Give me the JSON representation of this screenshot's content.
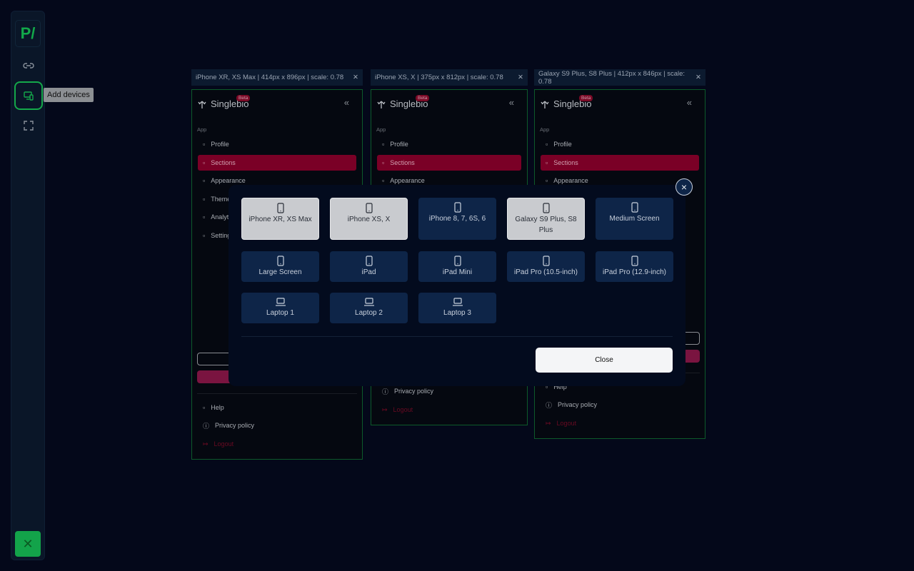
{
  "sidebar": {
    "logo": "P/",
    "tooltip": "Add devices",
    "icons": [
      "link-icon",
      "devices-icon",
      "fullscreen-icon"
    ],
    "exit_icon": "close-icon",
    "accent": "#13a34a"
  },
  "frames": [
    {
      "header": "iPhone XR, XS Max | 414px x 896px | scale: 0.78"
    },
    {
      "header": "iPhone XS, X | 375px x 812px | scale: 0.78"
    },
    {
      "header": "Galaxy S9 Plus, S8 Plus | 412px x 846px | scale: 0.78"
    }
  ],
  "app_preview": {
    "brand": "Singlebio",
    "beta": "Beta",
    "collapse": "«",
    "section_label": "App",
    "menu": [
      "Profile",
      "Sections",
      "Appearance",
      "Themes",
      "Analytics",
      "Settings"
    ],
    "active": "Sections",
    "help": "Help",
    "privacy": "Privacy policy",
    "logout": "Logout",
    "active_color": "#7a0026"
  },
  "modal": {
    "devices": [
      {
        "label": "iPhone XR, XS Max",
        "type": "phone",
        "selected": true
      },
      {
        "label": "iPhone XS, X",
        "type": "phone",
        "selected": true
      },
      {
        "label": "iPhone 8, 7, 6S, 6",
        "type": "phone",
        "selected": false
      },
      {
        "label": "Galaxy S9 Plus, S8 Plus",
        "type": "phone",
        "selected": true
      },
      {
        "label": "Medium Screen",
        "type": "phone",
        "selected": false
      },
      {
        "label": "Large Screen",
        "type": "phone",
        "selected": false
      },
      {
        "label": "iPad",
        "type": "phone",
        "selected": false
      },
      {
        "label": "iPad Mini",
        "type": "phone",
        "selected": false
      },
      {
        "label": "iPad Pro (10.5-inch)",
        "type": "phone",
        "selected": false
      },
      {
        "label": "iPad Pro (12.9-inch)",
        "type": "phone",
        "selected": false
      },
      {
        "label": "Laptop 1",
        "type": "laptop",
        "selected": false
      },
      {
        "label": "Laptop 2",
        "type": "laptop",
        "selected": false
      },
      {
        "label": "Laptop 3",
        "type": "laptop",
        "selected": false
      }
    ],
    "close_label": "Close",
    "close_icon": "×"
  }
}
